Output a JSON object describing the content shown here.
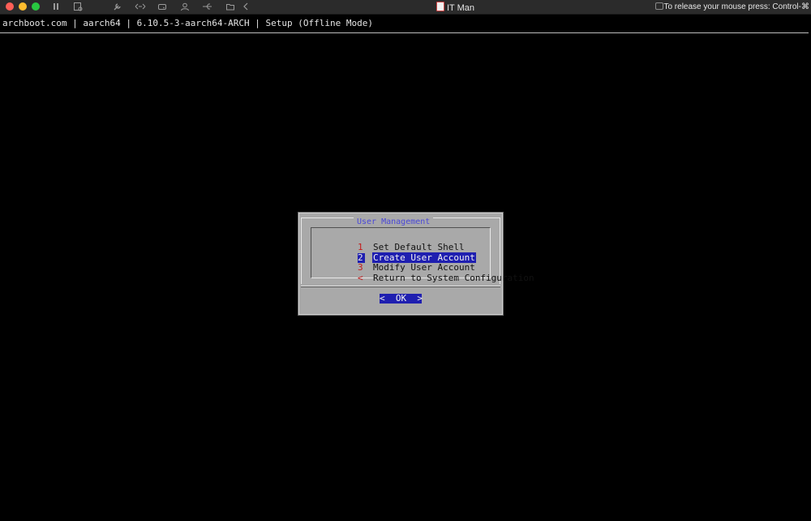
{
  "window": {
    "title": "IT Man",
    "release_hint": "To release your mouse press: Control-⌘"
  },
  "toolbar_icons": [
    "pause-icon",
    "snapshot-icon",
    "wrench-icon",
    "resize-arrows-icon",
    "drive-icon",
    "user-icon",
    "usb-icon",
    "folder-share-icon",
    "back-chevron-icon"
  ],
  "terminal": {
    "status_line": "archboot.com | aarch64 | 6.10.5-3-aarch64-ARCH | Setup (Offline Mode)"
  },
  "dialog": {
    "title": "User Management",
    "items": [
      {
        "tag": "1",
        "label": "Set Default Shell",
        "selected": false
      },
      {
        "tag": "2",
        "label": "Create User Account",
        "selected": true
      },
      {
        "tag": "3",
        "label": "Modify User Account",
        "selected": false
      },
      {
        "tag": "<",
        "label": "Return to System Configuration",
        "selected": false
      }
    ],
    "ok_button": {
      "left": "<",
      "label": "OK",
      "right": ">"
    }
  },
  "colors": {
    "selection": "#1f1fb0",
    "dialog_bg": "#a9a9a9",
    "tag": "#c41a1a",
    "title": "#4a48d8"
  }
}
